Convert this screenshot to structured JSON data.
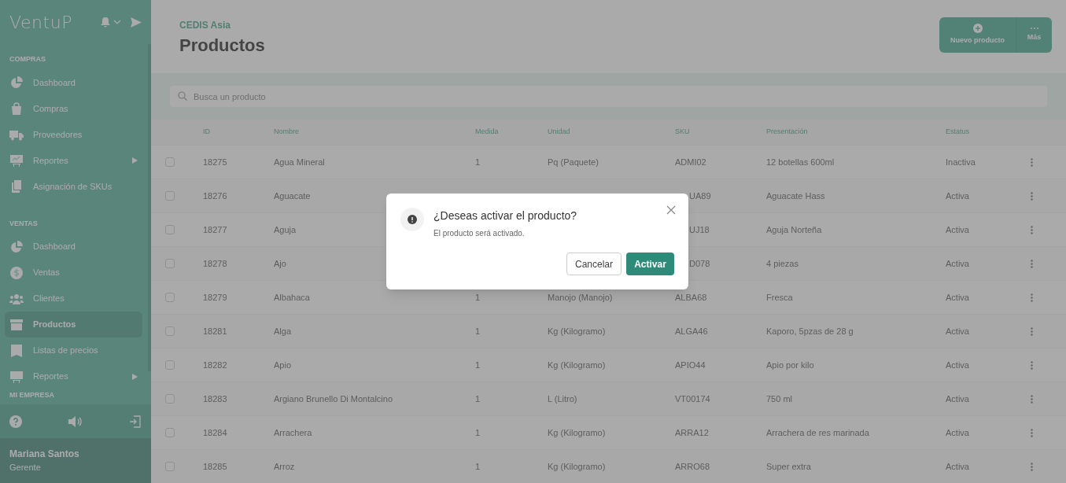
{
  "sidebar": {
    "logo": "VentuP",
    "sections": [
      {
        "title": "COMPRAS",
        "items": [
          {
            "label": "Dashboard",
            "selected": false,
            "submenu": false
          },
          {
            "label": "Compras",
            "selected": false,
            "submenu": false
          },
          {
            "label": "Proveedores",
            "selected": false,
            "submenu": false
          },
          {
            "label": "Reportes",
            "selected": false,
            "submenu": true
          },
          {
            "label": "Asignación de SKUs",
            "selected": false,
            "submenu": false
          }
        ]
      },
      {
        "title": "VENTAS",
        "items": [
          {
            "label": "Dashboard",
            "selected": false,
            "submenu": false
          },
          {
            "label": "Ventas",
            "selected": false,
            "submenu": false
          },
          {
            "label": "Clientes",
            "selected": false,
            "submenu": false
          },
          {
            "label": "Productos",
            "selected": true,
            "submenu": false
          },
          {
            "label": "Listas de precios",
            "selected": false,
            "submenu": false
          },
          {
            "label": "Reportes",
            "selected": false,
            "submenu": true
          }
        ]
      },
      {
        "title": "MI EMPRESA"
      }
    ],
    "user": {
      "name": "Mariana Santos",
      "role": "Gerente"
    }
  },
  "header": {
    "subtitle": "CEDIS Asia",
    "title": "Productos",
    "actions": [
      "Nuevo producto",
      "Más"
    ]
  },
  "search": {
    "placeholder": "Busca un producto"
  },
  "table": {
    "columns": [
      "ID",
      "Nombre",
      "Medida",
      "Unidad",
      "SKU",
      "Presentación",
      "Estatus"
    ],
    "rows": [
      {
        "cells": [
          "18275",
          "Agua Mineral",
          "1",
          "Pq (Paquete)",
          "ADMI02",
          "12 botellas 600ml",
          "Inactiva"
        ],
        "covered": false,
        "checked": false
      },
      {
        "cells": [
          "18276",
          "Aguacate",
          "",
          "",
          "UA89",
          "Aguacate Hass",
          "Activa"
        ],
        "covered": true,
        "checked": false
      },
      {
        "cells": [
          "18277",
          "Aguja",
          "",
          "",
          "UJ18",
          "Aguja Norteña",
          "Activa"
        ],
        "covered": true,
        "checked": false
      },
      {
        "cells": [
          "18278",
          "Ajo",
          "",
          "",
          "D078",
          "4 piezas",
          "Activa"
        ],
        "covered": true,
        "checked": false
      },
      {
        "cells": [
          "18279",
          "Albahaca",
          "1",
          "Manojo (Manojo)",
          "ALBA68",
          "Fresca",
          "Activa"
        ],
        "covered": false,
        "checked": false
      },
      {
        "cells": [
          "18281",
          "Alga",
          "1",
          "Kg (Kilogramo)",
          "ALGA46",
          "Kaporo, 5pzas de 28 g",
          "Activa"
        ],
        "covered": false,
        "checked": false
      },
      {
        "cells": [
          "18282",
          "Apio",
          "1",
          "Kg (Kilogramo)",
          "APIO44",
          "Apio por kilo",
          "Activa"
        ],
        "covered": false,
        "checked": false
      },
      {
        "cells": [
          "18283",
          "Argiano Brunello Di Montalcino",
          "1",
          "L (Litro)",
          "VT00174",
          "750 ml",
          "Activa"
        ],
        "covered": false,
        "checked": false
      },
      {
        "cells": [
          "18284",
          "Arrachera",
          "1",
          "Kg (Kilogramo)",
          "ARRA12",
          "Arrachera de res marinada",
          "Activa"
        ],
        "covered": false,
        "checked": false
      },
      {
        "cells": [
          "18285",
          "Arroz",
          "1",
          "Kg (Kilogramo)",
          "ARRO68",
          "Super extra",
          "Activa"
        ],
        "covered": false,
        "checked": false
      }
    ]
  },
  "dialog": {
    "title": "¿Deseas activar el producto?",
    "message": "El producto será activado.",
    "buttons": [
      "Cancelar",
      "Activar"
    ]
  }
}
